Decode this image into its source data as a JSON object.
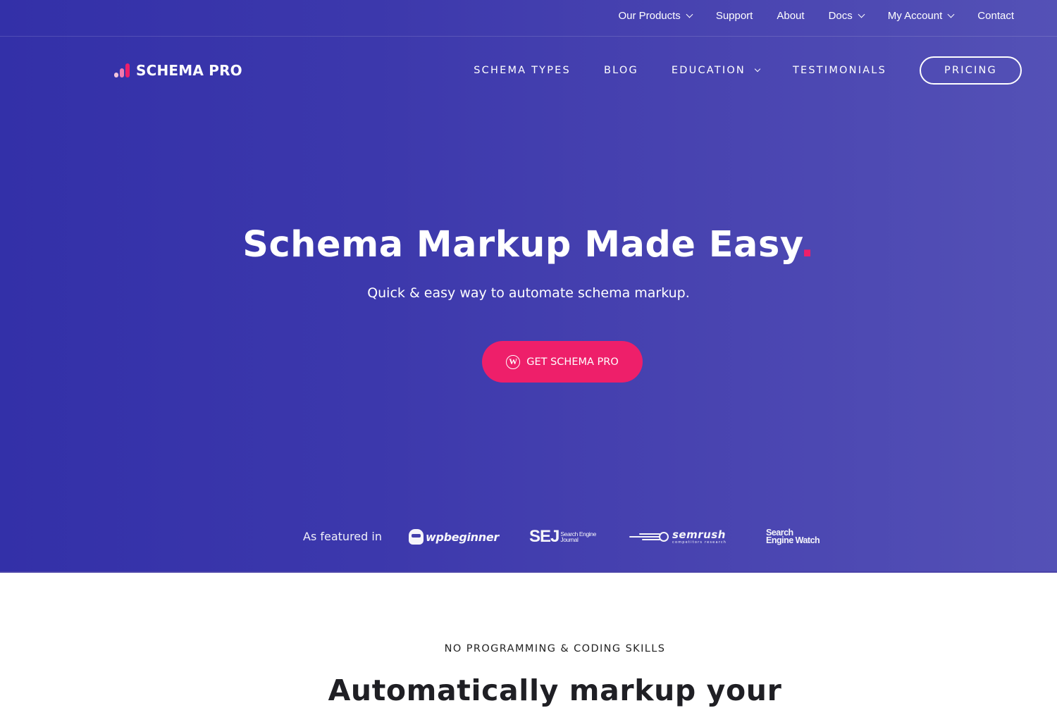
{
  "colors": {
    "hero_gradient_start": "#3330a8",
    "hero_gradient_end": "#5451b6",
    "accent": "#ee1f6a",
    "text_on_hero": "#ffffff",
    "heading_dark": "#1f1f24"
  },
  "topbar": {
    "items": [
      {
        "label": "Our Products",
        "has_dropdown": true
      },
      {
        "label": "Support",
        "has_dropdown": false
      },
      {
        "label": "About",
        "has_dropdown": false
      },
      {
        "label": "Docs",
        "has_dropdown": true
      },
      {
        "label": "My Account",
        "has_dropdown": true
      },
      {
        "label": "Contact",
        "has_dropdown": false
      }
    ]
  },
  "header": {
    "logo_text": "SCHEMA PRO",
    "logo_icon": "bar-chart-icon",
    "nav": [
      {
        "label": "SCHEMA TYPES",
        "has_dropdown": false
      },
      {
        "label": "BLOG",
        "has_dropdown": false
      },
      {
        "label": "EDUCATION",
        "has_dropdown": true
      },
      {
        "label": "TESTIMONIALS",
        "has_dropdown": false
      }
    ],
    "pricing_label": "PRICING"
  },
  "hero": {
    "title": "Schema Markup Made Easy",
    "title_punctuation": ".",
    "subtitle": "Quick & easy way to automate schema markup.",
    "cta_label": "GET SCHEMA PRO",
    "cta_icon": "wordpress-icon",
    "cta_icon_glyph": "W"
  },
  "featured": {
    "label": "As featured in",
    "logos": [
      {
        "name": "wpbeginner",
        "text": "wpbeginner"
      },
      {
        "name": "Search Engine Journal",
        "abbr": "SEJ",
        "line1": "Search Engine",
        "line2": "Journal"
      },
      {
        "name": "SEMrush",
        "text": "semrush",
        "tagline": "competitors research"
      },
      {
        "name": "Search Engine Watch",
        "line1": "Search",
        "line2": "Engine Watch"
      }
    ]
  },
  "section": {
    "eyebrow": "NO PROGRAMMING & CODING SKILLS",
    "title": "Automatically markup your"
  }
}
